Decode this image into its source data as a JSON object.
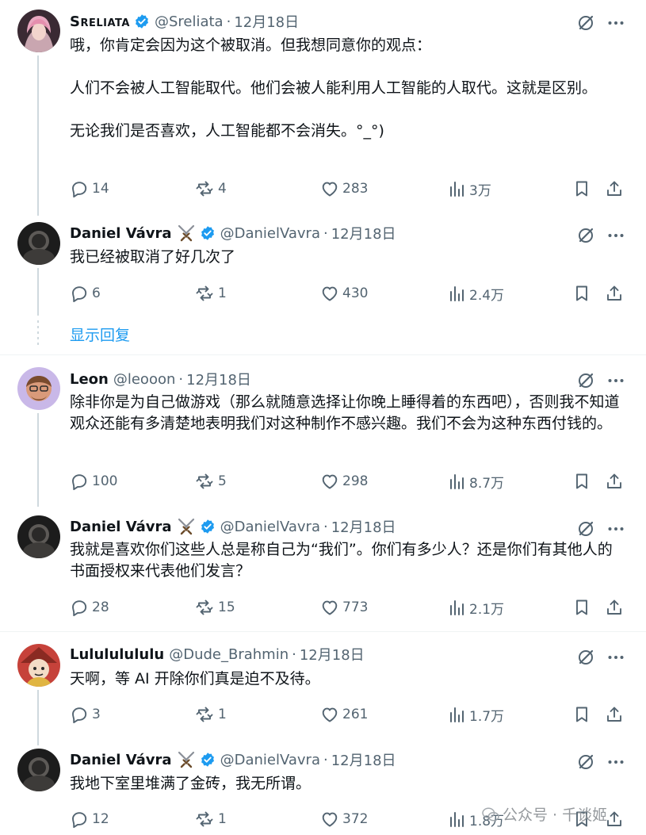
{
  "show_replies_label": "显示回复",
  "watermark": {
    "text": "公众号 · 千谈姬"
  },
  "colors": {
    "accent": "#1d9bf0",
    "muted": "#536471",
    "text": "#0f1419",
    "line": "#cfd9de"
  },
  "tweets": [
    {
      "name": "Sreliata",
      "handle": "@Sreliata",
      "time": "12月18日",
      "lines": [
        "哦，你肯定会因为这个被取消。但我想同意你的观点：",
        "",
        "人们不会被人工智能取代。他们会被人能利用人工智能的人取代。这就是区别。",
        "",
        "无论我们是否喜欢，人工智能都不会消失。°_°)"
      ],
      "replies": "14",
      "reposts": "4",
      "likes": "283",
      "views": "3万"
    },
    {
      "name": "Daniel Vávra",
      "handle": "@DanielVavra",
      "time": "12月18日",
      "lines": [
        "我已经被取消了好几次了"
      ],
      "replies": "6",
      "reposts": "1",
      "likes": "430",
      "views": "2.4万"
    },
    {
      "name": "Leon",
      "handle": "@leooon",
      "time": "12月18日",
      "lines": [
        "除非你是为自己做游戏（那么就随意选择让你晚上睡得着的东西吧），否则我不知道观众还能有多清楚地表明我们对这种制作不感兴趣。我们不会为这种东西付钱的。"
      ],
      "replies": "100",
      "reposts": "5",
      "likes": "298",
      "views": "8.7万"
    },
    {
      "name": "Daniel Vávra",
      "handle": "@DanielVavra",
      "time": "12月18日",
      "lines": [
        "我就是喜欢你们这些人总是称自己为“我们”。你们有多少人？还是你们有其他人的书面授权来代表他们发言？"
      ],
      "replies": "28",
      "reposts": "15",
      "likes": "773",
      "views": "2.1万"
    },
    {
      "name": "Lulululululu",
      "handle": "@Dude_Brahmin",
      "time": "12月18日",
      "lines": [
        "天啊，等 AI 开除你们真是迫不及待。"
      ],
      "replies": "3",
      "reposts": "1",
      "likes": "261",
      "views": "1.7万"
    },
    {
      "name": "Daniel Vávra",
      "handle": "@DanielVavra",
      "time": "12月18日",
      "lines": [
        "我地下室里堆满了金砖，我无所谓。"
      ],
      "replies": "12",
      "reposts": "1",
      "likes": "372",
      "views": "1.8万"
    }
  ]
}
